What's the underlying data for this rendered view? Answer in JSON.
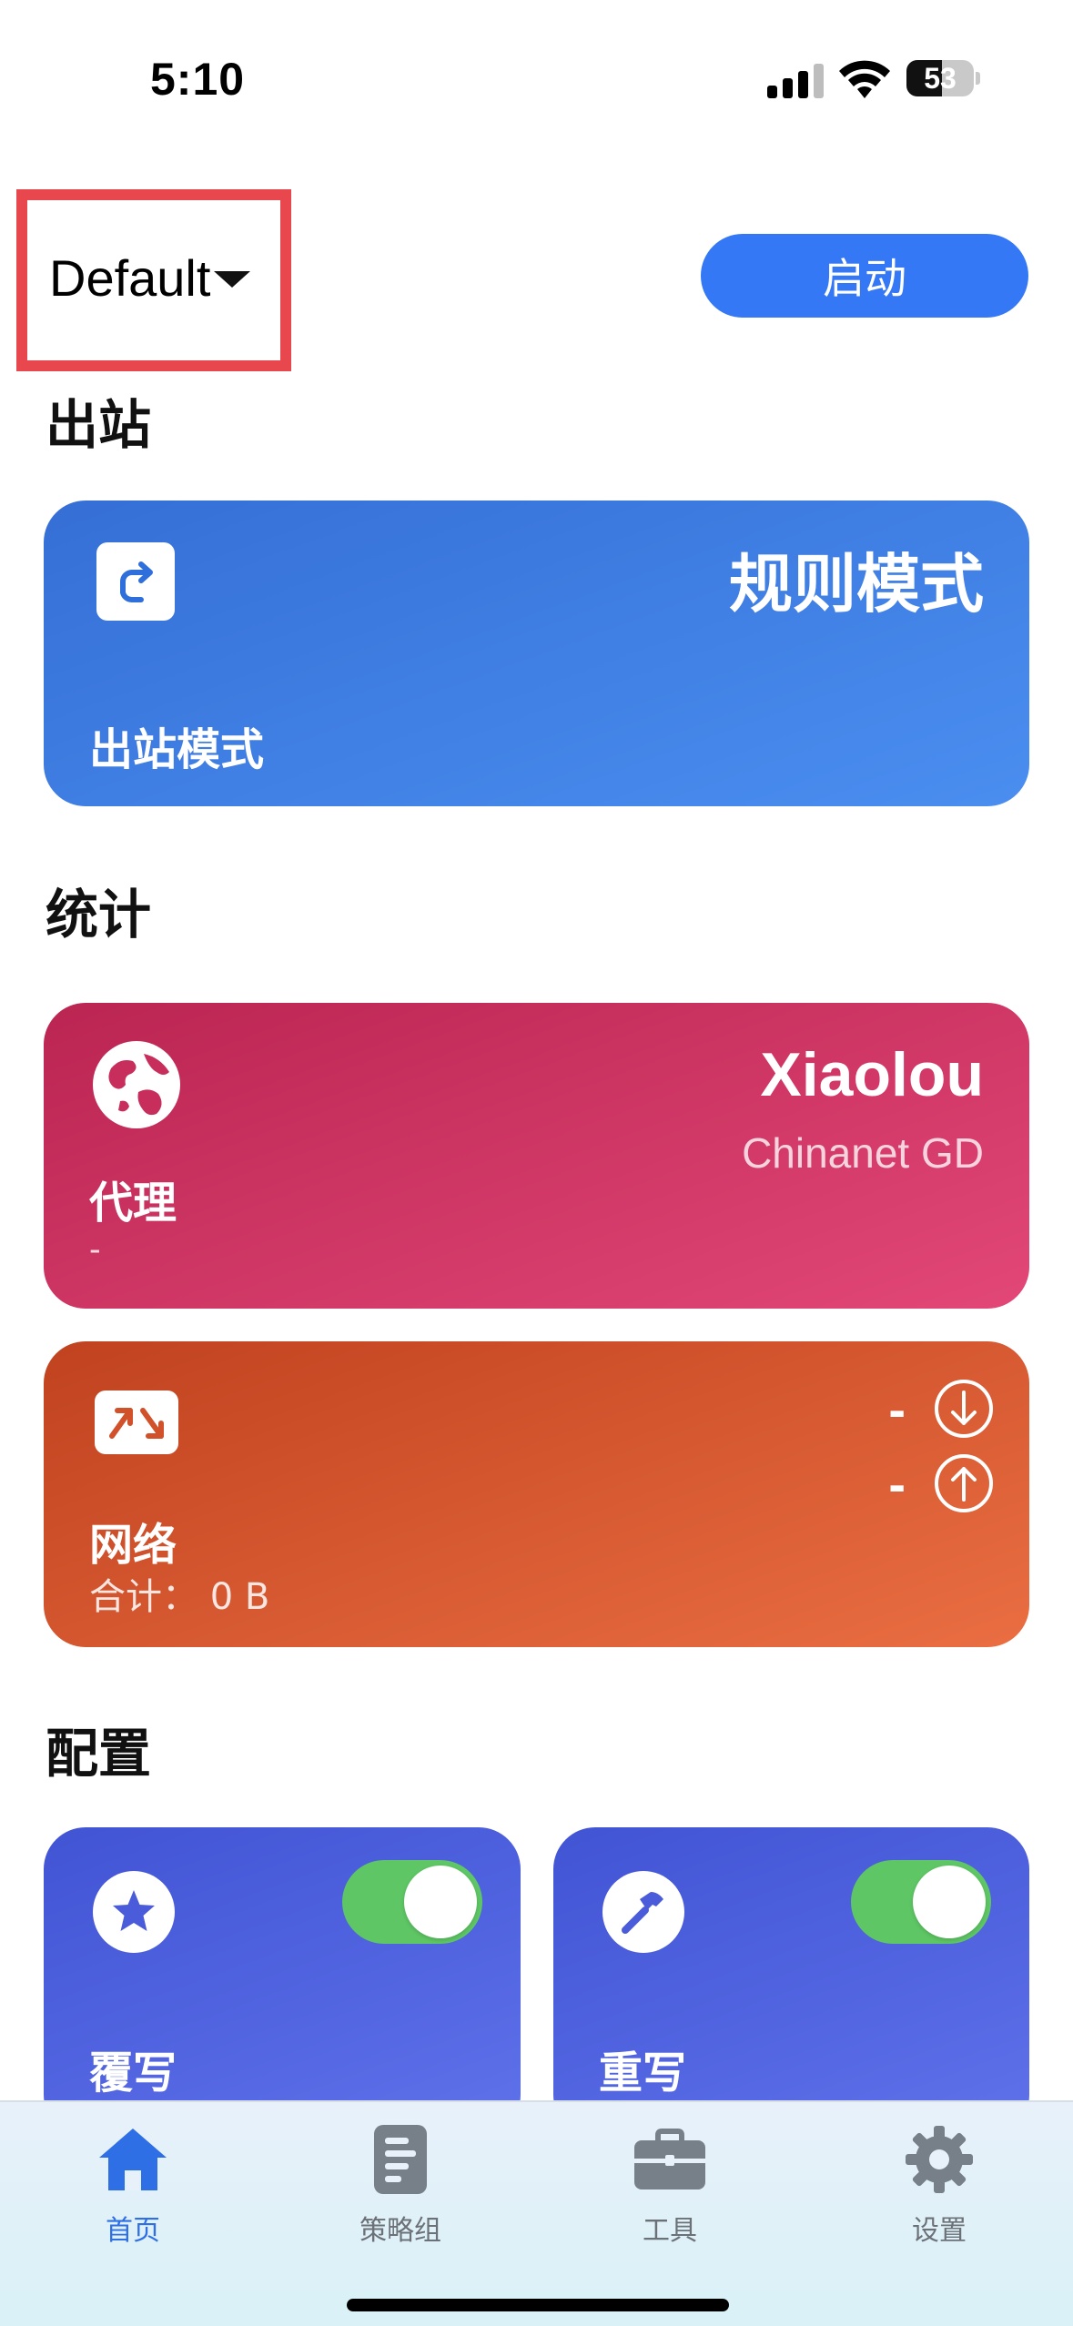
{
  "status_bar": {
    "time": "5:10",
    "battery_percent": "53",
    "battery_level": 0.53
  },
  "header": {
    "profile_name": "Default",
    "start_label": "启动"
  },
  "sections": {
    "outbound": "出站",
    "stats": "统计",
    "config": "配置"
  },
  "outbound_card": {
    "mode": "规则模式",
    "label": "出站模式",
    "icon": "redirect-arrow-icon"
  },
  "proxy_card": {
    "node": "Xiaolou",
    "isp": "Chinanet GD",
    "label": "代理",
    "sub": "-",
    "icon": "globe-icon"
  },
  "network_card": {
    "download": "-",
    "upload": "-",
    "label": "网络",
    "total_label": "合计：",
    "total_value": "0 B",
    "icon": "traffic-arrows-icon"
  },
  "config_cards": {
    "override": {
      "label": "覆写",
      "enabled": true,
      "icon": "star-icon"
    },
    "rewrite": {
      "label": "重写",
      "enabled": true,
      "icon": "hammer-icon"
    }
  },
  "tabs": [
    {
      "label": "首页",
      "icon": "home-icon",
      "active": true
    },
    {
      "label": "策略组",
      "icon": "document-icon",
      "active": false
    },
    {
      "label": "工具",
      "icon": "toolbox-icon",
      "active": false
    },
    {
      "label": "设置",
      "icon": "gear-icon",
      "active": false
    }
  ],
  "colors": {
    "accent": "#3478f6",
    "outbound_card": "#3f7de3",
    "proxy_card": "#cf3463",
    "network_card": "#d8582f",
    "config_card": "#4f62df",
    "toggle_on": "#5ec664",
    "highlight_box": "#e8474d"
  }
}
